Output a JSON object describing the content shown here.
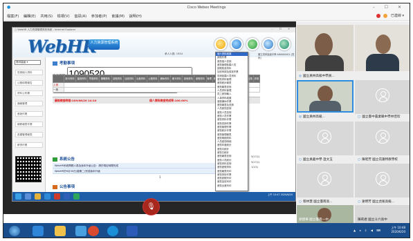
{
  "webex": {
    "title": "Cisco Webex Meetings",
    "menu": [
      "檔案(F)",
      "編輯(E)",
      "共用(S)",
      "檢視(V)",
      "音訊(A)",
      "參加者(P)",
      "會議(M)",
      "說明(H)"
    ],
    "status": "已連線"
  },
  "ie": {
    "title": "○ WebHR 人力資源管理資訊系統 - Internet Explorer"
  },
  "webhr": {
    "logo": "WebHR",
    "logo_sub": "人力資源管理系統",
    "user_line": "承人人員: 1934",
    "right_line": "國立員林高級中學 AB0000001 [員林]",
    "nav_select": "員林高級",
    "nav_items": [
      "查詢個人資料",
      "公務填寫報告",
      "資料公布欄",
      "通報管理",
      "差勤作業",
      "報薪報表作業",
      "各類管理報表",
      "薪資作業"
    ],
    "section_attendance": "考勤事項",
    "date_label": "查核日期:",
    "date_from": "1090520",
    "date_to": "1090620",
    "query_btn": "查詢",
    "close_btn": "刷新",
    "table_headers": [
      "缺卡資料",
      "遲到資料",
      "早退資料",
      "曠職資料",
      "請假資料",
      "加班資料",
      "出差資料",
      "公假資料",
      "補休資料",
      "補卡資料",
      "其他資料",
      "差假資料",
      "管理",
      "其他",
      "其他",
      "未處理",
      "主管",
      "核准",
      "簽核",
      "評核"
    ],
    "row_labels": [
      "上班",
      "一般"
    ],
    "pending_left": "最後檢查時間:109/06/20 14:10",
    "pending_right": "個人資料檢查完成率:100.00%",
    "section_announce": "系統公告",
    "announcements": [
      "WebHR系統問題人員及版本升級公告：請於規定時間完成",
      "WebHR於6月30日(星期二)完成版本升級",
      "1"
    ],
    "section_official": "公告事項",
    "official_row": "本科公告事項：請於webHR內填寫各項個人人事資料確認(e-mail、電話)",
    "official_date": "109年11月17日",
    "right_texts": [
      "5/17(1)",
      "5/17(1)",
      "1/1(1)"
    ],
    "page_number": "1 2",
    "inner_clock": "上午 10:47\n2020/6/20"
  },
  "dropdown": [
    "個人資料維護",
    "請假作業",
    "差勤個人查詢",
    "差勤管理各類人員",
    "請假核准資料",
    "加班申請及核准作業",
    "查詢各類人員資料",
    "差勤資料管理",
    "差勤統計報表",
    "差勤報表查詢",
    "人員資料管理",
    "員工差勤輸入",
    "人事資料維護",
    "差假補休作業",
    "差勤報表及查詢",
    "人員差勤查詢",
    "差勤人員查詢",
    "差勤人員作業",
    "差勤資料作業",
    "差勤查詢作業",
    "差勤管理作業",
    "差勤統計作業",
    "差勤管理報表",
    "差勤明細資料",
    "人員差勤明細",
    "差勤年度統計",
    "差勤月統計",
    "差勤日統計",
    "差勤報表查詢",
    "差勤人員統計",
    "差勤資料查詢",
    "差勤差假資料",
    "差勤報表列印",
    "差勤排班作業",
    "差勤請假列印",
    "差勤加班列印",
    "差勤出差列印"
  ],
  "participants": [
    {
      "label": "國立員林高級中學員...",
      "role": "主持人",
      "type": "video"
    },
    {
      "label": "",
      "type": "video"
    },
    {
      "label": "國立員林高級...",
      "role": "主持人",
      "type": "video-selected"
    },
    {
      "label": "國立臺中農業職中學林佳欣",
      "type": "avatar"
    },
    {
      "label": "國立員義中學 溫文玉",
      "type": "avatar"
    },
    {
      "label": "陳昭芳 國立花蓮特教學校",
      "type": "avatar"
    },
    {
      "label": "蔡林慧 國立臺南高...",
      "type": "avatar"
    },
    {
      "label": "謝明芳 國立虎尾高級...",
      "type": "avatar"
    },
    {
      "label": "廖建華 國立臺南一中",
      "type": "video"
    },
    {
      "label": "陳莉君 國立斗六高中",
      "type": "avatar"
    }
  ],
  "taskbar": {
    "clock_time": "上午 10:48",
    "clock_date": "2020/6/20"
  }
}
